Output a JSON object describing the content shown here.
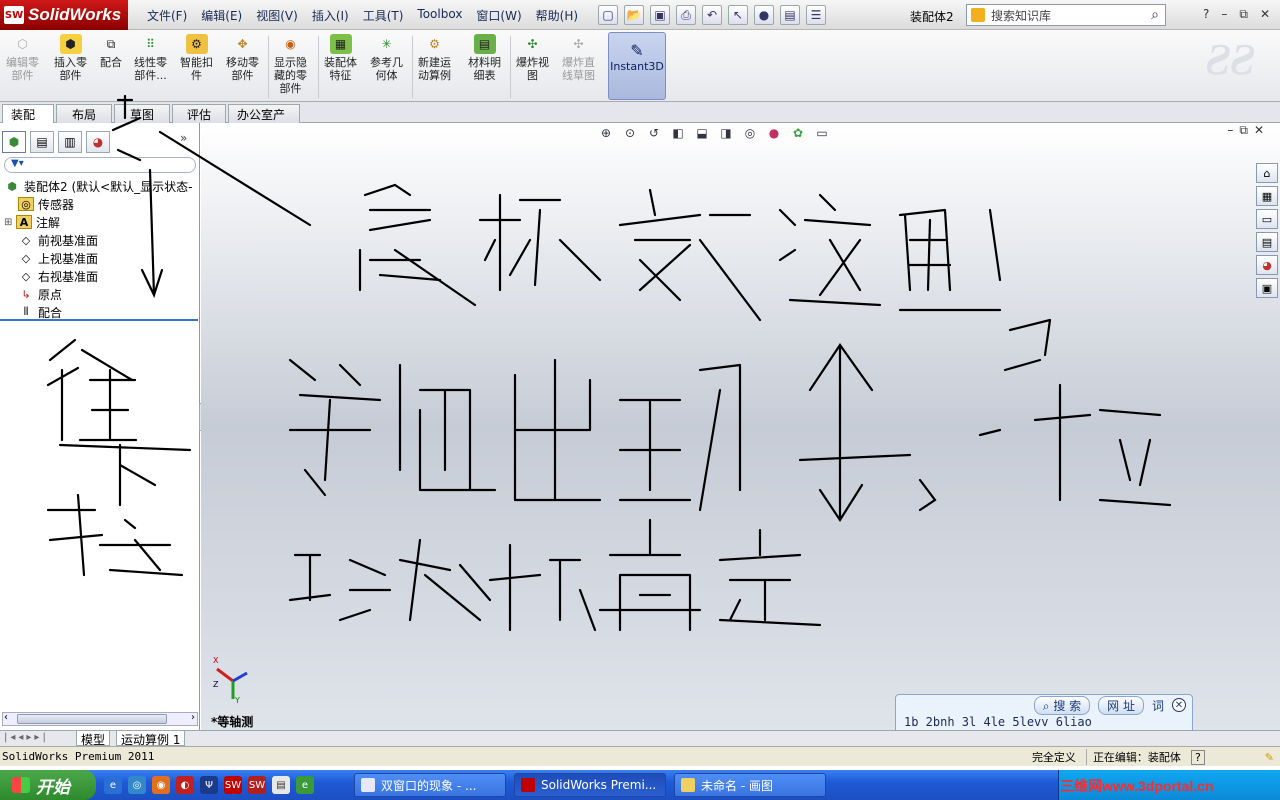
{
  "app": {
    "logo_text": "SolidWorks",
    "doc_title": "装配体2",
    "menus": [
      "文件(F)",
      "编辑(E)",
      "视图(V)",
      "插入(I)",
      "工具(T)",
      "Toolbox",
      "窗口(W)",
      "帮助(H)"
    ],
    "search_placeholder": "搜索知识库",
    "help_label": "?",
    "win_controls": [
      "–",
      "⧉",
      "✕"
    ]
  },
  "commands": [
    {
      "label": "编辑零\n部件",
      "enabled": false
    },
    {
      "label": "插入零\n部件",
      "enabled": true
    },
    {
      "label": "配合",
      "enabled": true
    },
    {
      "label": "线性零\n部件...",
      "enabled": true
    },
    {
      "label": "智能扣\n件",
      "enabled": true
    },
    {
      "label": "移动零\n部件",
      "enabled": true
    },
    {
      "label": "显示隐\n藏的零\n部件",
      "enabled": true
    },
    {
      "label": "装配体\n特征",
      "enabled": true
    },
    {
      "label": "参考几\n何体",
      "enabled": true
    },
    {
      "label": "新建运\n动算例",
      "enabled": true
    },
    {
      "label": "材料明\n细表",
      "enabled": true
    },
    {
      "label": "爆炸视\n图",
      "enabled": true
    },
    {
      "label": "爆炸直\n线草图",
      "enabled": false
    }
  ],
  "instant3d_label": "Instant3D",
  "tabs": [
    "装配体",
    "布局",
    "草图",
    "评估",
    "办公室产品"
  ],
  "feature_tree": {
    "root": "装配体2  (默认<默认_显示状态-",
    "items": [
      "传感器",
      "注解",
      "前视基准面",
      "上视基准面",
      "右视基准面",
      "原点",
      "配合"
    ]
  },
  "viewport": {
    "view_label": "*等轴测",
    "triad": {
      "x": "X",
      "y": "Y",
      "z": "Z"
    }
  },
  "handwriting": {
    "main_text": "鼠标放这里 等他出现 ↕，一拉 就大功搞定",
    "side_text": "往下拉"
  },
  "widget": {
    "search_btn": "搜 索",
    "url_btn": "网 址",
    "word_btn": "词",
    "close": "✕",
    "input_text": "1b 2bnh 3l 4le 5levv 6liao"
  },
  "bottom_tabs": [
    "模型",
    "运动算例 1"
  ],
  "status": {
    "product": "SolidWorks Premium 2011",
    "state": "完全定义",
    "editing": "正在编辑：装配体",
    "help": "?"
  },
  "taskbar": {
    "start": "开始",
    "items": [
      {
        "label": "双窗口的现象 - ..."
      },
      {
        "label": "SolidWorks Premi..."
      },
      {
        "label": "未命名 - 画图"
      }
    ],
    "watermark": "三维网www.3dportal.cn"
  },
  "colors": {
    "brand_red": "#c00000",
    "accent_blue": "#3a74c4",
    "taskbar_blue": "#1e5ad6",
    "ink": "#000000"
  }
}
